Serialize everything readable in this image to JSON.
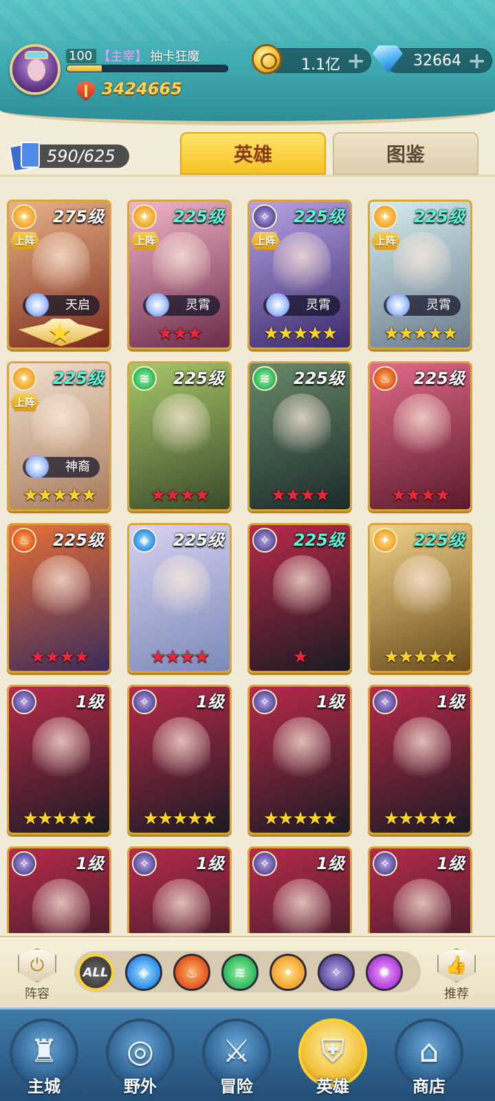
{
  "player": {
    "level": "100",
    "title": "【主宰】",
    "name": "抽卡狂魔",
    "xp_fraction": 0.22,
    "power": "3424665"
  },
  "currency": {
    "gold": "1.1亿",
    "gems": "32664",
    "plus": "+"
  },
  "heroes": {
    "count": "590/625"
  },
  "tabs": {
    "heroes": "英雄",
    "codex": "图鉴"
  },
  "cards": [
    {
      "element": "light",
      "level": "275级",
      "level_color": "white",
      "deployed": "上阵",
      "faction": "天启",
      "stars": "",
      "star_color": "gold",
      "special": "winged-star",
      "bg": [
        "#e9b38a",
        "#7a2a1a"
      ]
    },
    {
      "element": "light",
      "level": "225级",
      "level_color": "cyan",
      "deployed": "上阵",
      "faction": "灵霄",
      "stars": "★★★",
      "star_color": "red",
      "special": "",
      "bg": [
        "#f2b6c8",
        "#6a2a4a"
      ]
    },
    {
      "element": "dark",
      "level": "225级",
      "level_color": "cyan",
      "deployed": "上阵",
      "faction": "灵霄",
      "stars": "★★★★★",
      "star_color": "gold",
      "special": "",
      "bg": [
        "#b8a2e6",
        "#3a2a6a"
      ]
    },
    {
      "element": "light",
      "level": "225级",
      "level_color": "cyan",
      "deployed": "上阵",
      "faction": "灵霄",
      "stars": "★★★★★",
      "star_color": "gold",
      "special": "",
      "bg": [
        "#d6eef2",
        "#6a7a8a"
      ]
    },
    {
      "element": "light",
      "level": "225级",
      "level_color": "cyan",
      "deployed": "上阵",
      "faction": "神裔",
      "stars": "★★★★★",
      "star_color": "gold",
      "special": "",
      "bg": [
        "#f2e2d2",
        "#a87a5a"
      ]
    },
    {
      "element": "nature",
      "level": "225级",
      "level_color": "white",
      "deployed": "",
      "faction": "",
      "stars": "★★★★",
      "star_color": "red",
      "special": "",
      "bg": [
        "#a8c86a",
        "#3a4a2a"
      ]
    },
    {
      "element": "nature",
      "level": "225级",
      "level_color": "white",
      "deployed": "",
      "faction": "",
      "stars": "★★★★",
      "star_color": "red",
      "special": "",
      "bg": [
        "#6a8a6a",
        "#1a2a2a"
      ]
    },
    {
      "element": "fire",
      "level": "225级",
      "level_color": "white",
      "deployed": "",
      "faction": "",
      "stars": "★★★★",
      "star_color": "red",
      "special": "",
      "bg": [
        "#e26a8a",
        "#5a1a2a"
      ]
    },
    {
      "element": "fire",
      "level": "225级",
      "level_color": "white",
      "deployed": "",
      "faction": "",
      "stars": "★★★★",
      "star_color": "red",
      "special": "",
      "bg": [
        "#e8703a",
        "#3a2a5a"
      ]
    },
    {
      "element": "water",
      "level": "225级",
      "level_color": "white",
      "deployed": "",
      "faction": "",
      "stars": "★★★★",
      "star_color": "red",
      "special": "",
      "bg": [
        "#d8d2f2",
        "#7a8ab8"
      ]
    },
    {
      "element": "dark",
      "level": "225级",
      "level_color": "cyan",
      "deployed": "",
      "faction": "",
      "stars": "★",
      "star_color": "red",
      "special": "",
      "bg": [
        "#b82a4a",
        "#1a1a22"
      ]
    },
    {
      "element": "light",
      "level": "225级",
      "level_color": "cyan",
      "deployed": "",
      "faction": "",
      "stars": "★★★★★",
      "star_color": "gold",
      "special": "",
      "bg": [
        "#f2d28a",
        "#6a4a1a"
      ]
    },
    {
      "element": "dark",
      "level": "1级",
      "level_color": "white",
      "deployed": "",
      "faction": "",
      "stars": "★★★★★",
      "star_color": "gold",
      "special": "",
      "bg": [
        "#b82a4a",
        "#1a1a22"
      ]
    },
    {
      "element": "dark",
      "level": "1级",
      "level_color": "white",
      "deployed": "",
      "faction": "",
      "stars": "★★★★★",
      "star_color": "gold",
      "special": "",
      "bg": [
        "#b82a4a",
        "#1a1a22"
      ]
    },
    {
      "element": "dark",
      "level": "1级",
      "level_color": "white",
      "deployed": "",
      "faction": "",
      "stars": "★★★★★",
      "star_color": "gold",
      "special": "",
      "bg": [
        "#b82a4a",
        "#1a1a22"
      ]
    },
    {
      "element": "dark",
      "level": "1级",
      "level_color": "white",
      "deployed": "",
      "faction": "",
      "stars": "★★★★★",
      "star_color": "gold",
      "special": "",
      "bg": [
        "#b82a4a",
        "#1a1a22"
      ]
    },
    {
      "element": "dark",
      "level": "1级",
      "level_color": "white",
      "deployed": "",
      "faction": "",
      "stars": "",
      "star_color": "gold",
      "special": "",
      "bg": [
        "#b82a4a",
        "#1a1a22"
      ]
    },
    {
      "element": "dark",
      "level": "1级",
      "level_color": "white",
      "deployed": "",
      "faction": "",
      "stars": "",
      "star_color": "gold",
      "special": "",
      "bg": [
        "#b82a4a",
        "#1a1a22"
      ]
    },
    {
      "element": "dark",
      "level": "1级",
      "level_color": "white",
      "deployed": "",
      "faction": "",
      "stars": "",
      "star_color": "gold",
      "special": "",
      "bg": [
        "#b82a4a",
        "#1a1a22"
      ]
    },
    {
      "element": "dark",
      "level": "1级",
      "level_color": "white",
      "deployed": "",
      "faction": "",
      "stars": "",
      "star_color": "gold",
      "special": "",
      "bg": [
        "#b82a4a",
        "#1a1a22"
      ]
    }
  ],
  "filters": {
    "lineup": "阵容",
    "recommend": "推荐",
    "all": "ALL",
    "elements": [
      "water",
      "fire",
      "nature",
      "light",
      "dark",
      "void"
    ]
  },
  "nav": [
    {
      "label": "主城",
      "icon": "castle-icon",
      "glyph": "♜",
      "active": false
    },
    {
      "label": "野外",
      "icon": "portal-icon",
      "glyph": "◎",
      "active": false
    },
    {
      "label": "冒险",
      "icon": "sword-icon",
      "glyph": "⚔",
      "active": false
    },
    {
      "label": "英雄",
      "icon": "helmet-icon",
      "glyph": "⛨",
      "active": true
    },
    {
      "label": "商店",
      "icon": "shop-icon",
      "glyph": "⌂",
      "active": false
    }
  ]
}
